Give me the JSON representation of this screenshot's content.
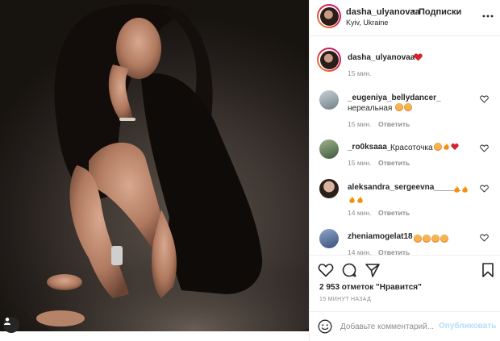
{
  "post": {
    "author": "dasha_ulyanovaa",
    "follow_separator": "•",
    "follow_label": "Подписки",
    "location": "Kyiv, Ukraine"
  },
  "caption": {
    "username": "dasha_ulyanovaa",
    "time": "15 мин."
  },
  "comments": [
    {
      "username": "_eugeniya_bellydancer_",
      "text": "нереальная",
      "time": "15 мин.",
      "reply": "Ответить",
      "emojis": [
        "heart-eyes-emoji",
        "heart-eyes-emoji"
      ]
    },
    {
      "username": "_ro0ksaaa_",
      "text": "Красоточка",
      "time": "15 мин.",
      "reply": "Ответить",
      "emojis": [
        "heart-eyes-emoji",
        "fire-emoji",
        "red-heart-emoji"
      ]
    },
    {
      "username": "aleksandra_sergeevna______",
      "text": "",
      "time": "14 мин.",
      "reply": "Ответить",
      "emojis": [
        "fire-emoji",
        "fire-emoji",
        "fire-emoji",
        "fire-emoji"
      ]
    },
    {
      "username": "zheniamogelat18",
      "text": "",
      "time": "14 мин.",
      "reply": "Ответить",
      "emojis": [
        "heart-eyes-emoji",
        "heart-eyes-emoji",
        "heart-eyes-emoji",
        "heart-eyes-emoji"
      ]
    }
  ],
  "likes_text": "2 953 отметок \"Нравится\"",
  "time_ago": "15 МИНУТ НАЗАД",
  "add_comment": {
    "placeholder": "Добавьте комментарий...",
    "post_label": "Опубликовать"
  },
  "colors": {
    "heart_red": "#ed4956",
    "post_button_disabled": "#b2dffc",
    "meta_gray": "#8e8e8e"
  },
  "icons": [
    "more-options-icon",
    "like-icon",
    "comment-icon",
    "share-icon",
    "bookmark-icon",
    "emoji-icon",
    "user-tag-icon"
  ]
}
